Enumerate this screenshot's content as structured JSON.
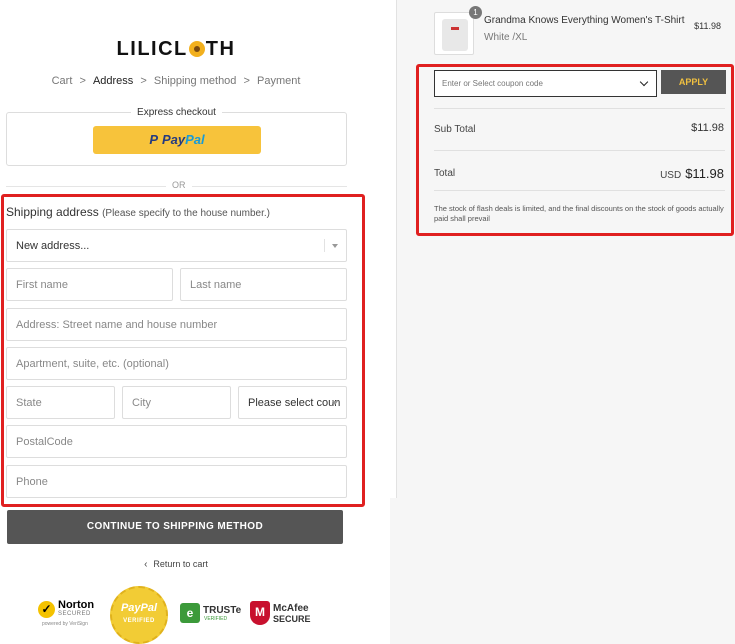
{
  "brand": {
    "logo_left": "LILICL",
    "logo_right": "TH"
  },
  "breadcrumb": [
    "Cart",
    "Address",
    "Shipping method",
    "Payment"
  ],
  "breadcrumb_sep": ">",
  "express": {
    "title": "Express checkout",
    "paypal_a": "Pay",
    "paypal_b": "Pal",
    "paypal_mark": "P"
  },
  "or_label": "OR",
  "shipping": {
    "title": "Shipping address",
    "note": "(Please specify to the house number.)",
    "address_select": "New address...",
    "first_name_placeholder": "First name",
    "last_name_placeholder": "Last name",
    "address_placeholder": "Address: Street name and house number",
    "apartment_placeholder": "Apartment, suite, etc. (optional)",
    "state_placeholder": "State",
    "city_placeholder": "City",
    "country_select": "Please select coun",
    "postal_placeholder": "PostalCode",
    "phone_placeholder": "Phone"
  },
  "continue_label": "CONTINUE TO SHIPPING METHOD",
  "return_label": "Return to cart",
  "return_arrow": "‹",
  "badges": {
    "norton": {
      "check": "✓",
      "name": "Norton",
      "sub": "SECURED",
      "powered": "powered by VeriSign"
    },
    "paypal": {
      "name": "PayPal",
      "sub": "VERIFIED"
    },
    "truste": {
      "icon": "e",
      "name": "TRUSTe",
      "sub": "VERIFIED"
    },
    "mcafee": {
      "icon": "M",
      "name": "McAfee",
      "sub": "SECURE"
    }
  },
  "product": {
    "name": "Grandma Knows Everything Women's T-Shirt",
    "variant": "White /XL",
    "price": "$11.98",
    "quantity": "1"
  },
  "coupon": {
    "placeholder": "Enter or Select coupon code",
    "apply_label": "APPLY"
  },
  "summary": {
    "subtotal_label": "Sub Total",
    "subtotal_value": "$11.98",
    "total_label": "Total",
    "currency": "USD",
    "total_value": "$11.98",
    "notice": "The stock of flash deals is limited, and the final discounts on the stock of goods actually paid shall prevail"
  },
  "colors": {
    "accent": "#e02020",
    "paypal_yellow": "#f7c33b",
    "button_dark": "#555555",
    "apply_text": "#f0c040"
  }
}
